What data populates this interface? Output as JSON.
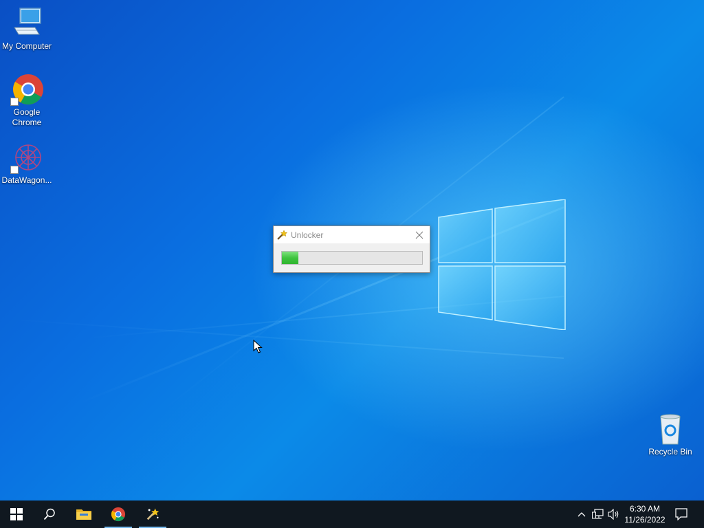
{
  "desktop": {
    "icons": [
      {
        "label": "My Computer",
        "icon": "computer-icon"
      },
      {
        "label": "Google Chrome",
        "icon": "chrome-icon"
      },
      {
        "label": "DataWagon...",
        "icon": "datawagon-icon"
      },
      {
        "label": "Recycle Bin",
        "icon": "recycle-bin-icon"
      }
    ]
  },
  "dialog": {
    "title": "Unlocker",
    "icon": "magic-wand-icon",
    "progress_fraction": 0.12,
    "progress_color": "#3fc43f"
  },
  "taskbar": {
    "buttons": [
      {
        "icon": "windows-start-icon"
      },
      {
        "icon": "search-icon"
      },
      {
        "icon": "file-explorer-icon"
      },
      {
        "icon": "chrome-icon"
      },
      {
        "icon": "unlocker-icon"
      }
    ],
    "tray": {
      "time": "6:30 AM",
      "date": "11/26/2022",
      "icons": [
        "chevron-up-icon",
        "network-icon",
        "volume-icon",
        "notification-icon"
      ]
    }
  },
  "colors": {
    "desktop_accent": "#0a6ee0",
    "taskbar": "#101820"
  }
}
